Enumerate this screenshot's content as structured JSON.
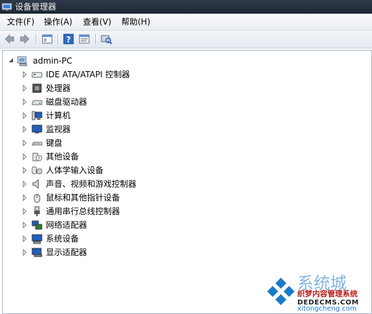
{
  "window": {
    "title": "设备管理器"
  },
  "menu": {
    "items": [
      {
        "label": "文件(F)"
      },
      {
        "label": "操作(A)"
      },
      {
        "label": "查看(V)"
      },
      {
        "label": "帮助(H)"
      }
    ]
  },
  "toolbar": {
    "buttons": [
      {
        "icon": "back-arrow-icon"
      },
      {
        "icon": "forward-arrow-icon"
      },
      {
        "icon": "show-hide-console-tree-icon"
      },
      {
        "icon": "help-icon"
      },
      {
        "icon": "properties-icon"
      },
      {
        "icon": "scan-hardware-icon"
      }
    ]
  },
  "tree": {
    "root": {
      "label": "admin-PC",
      "icon": "computer-root-icon",
      "expanded": true
    },
    "categories": [
      {
        "label": "IDE ATA/ATAPI 控制器",
        "icon": "ide-controller-icon"
      },
      {
        "label": "处理器",
        "icon": "processor-icon"
      },
      {
        "label": "磁盘驱动器",
        "icon": "disk-drive-icon"
      },
      {
        "label": "计算机",
        "icon": "computer-icon"
      },
      {
        "label": "监视器",
        "icon": "monitor-icon"
      },
      {
        "label": "键盘",
        "icon": "keyboard-icon"
      },
      {
        "label": "其他设备",
        "icon": "unknown-device-icon"
      },
      {
        "label": "人体学输入设备",
        "icon": "hid-icon"
      },
      {
        "label": "声音、视频和游戏控制器",
        "icon": "sound-icon"
      },
      {
        "label": "鼠标和其他指针设备",
        "icon": "mouse-icon"
      },
      {
        "label": "通用串行总线控制器",
        "icon": "usb-icon"
      },
      {
        "label": "网络适配器",
        "icon": "network-adapter-icon"
      },
      {
        "label": "系统设备",
        "icon": "system-device-icon"
      },
      {
        "label": "显示适配器",
        "icon": "display-adapter-icon"
      }
    ]
  },
  "watermark": {
    "logo_text": "系统城",
    "line1": "织梦内容管理系统",
    "line2": "DEDECMS.COM",
    "line3": "xitongcheng.com"
  },
  "colors": {
    "titlebar": "#2f3b4a",
    "tree_border": "#a9b3c1",
    "watermark_blue": "#1a7ac8",
    "watermark_red": "#b51d1d"
  }
}
